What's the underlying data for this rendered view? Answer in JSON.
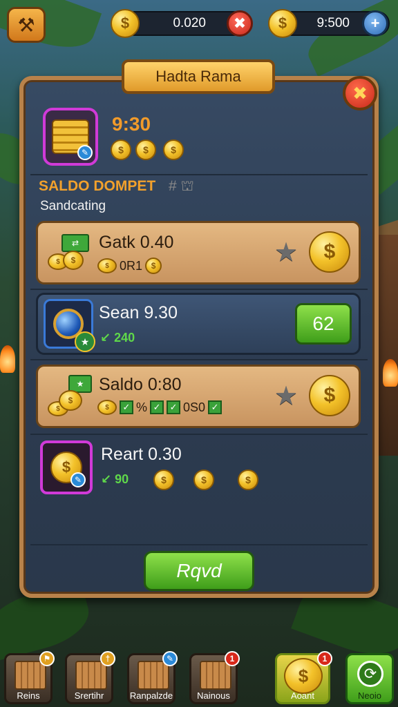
{
  "topbar": {
    "coins_left_value": "0.020",
    "coins_right_value": "9:500",
    "add_symbol": "+",
    "remove_symbol": "✖"
  },
  "panel": {
    "title": "Hadta Rama",
    "balance": "9:30",
    "section_title": "SALDO DOMPET",
    "section_icons": "# ⛫",
    "section_subtitle": "Sandcating",
    "rows": [
      {
        "title": "Gatk 0.40",
        "sub": "0R1",
        "style": "tan"
      },
      {
        "title": "Sean 9.30",
        "sub": "↙ 240",
        "button": "62",
        "style": "blue"
      },
      {
        "title": "Saldo 0:80",
        "sub_parts": [
          "%",
          "0S0"
        ],
        "style": "tan"
      },
      {
        "title": "Reart 0.30",
        "sub": "↙ 90",
        "style": "blue"
      }
    ],
    "confirm_button": "Rqvd"
  },
  "bottom_nav": [
    {
      "label": "Reins",
      "badge": "⚑"
    },
    {
      "label": "Srertihr",
      "badge": "†"
    },
    {
      "label": "Ranpalzde",
      "badge": "✎"
    },
    {
      "label": "Nainous",
      "badge": "1"
    },
    {
      "label": "Aoant",
      "badge": "1"
    },
    {
      "label": "Neoio"
    }
  ],
  "colors": {
    "accent_orange": "#f29b2a",
    "panel_bg": "#2c3b50",
    "gold": "#f3c22a",
    "green_button": "#3f9e1a"
  }
}
